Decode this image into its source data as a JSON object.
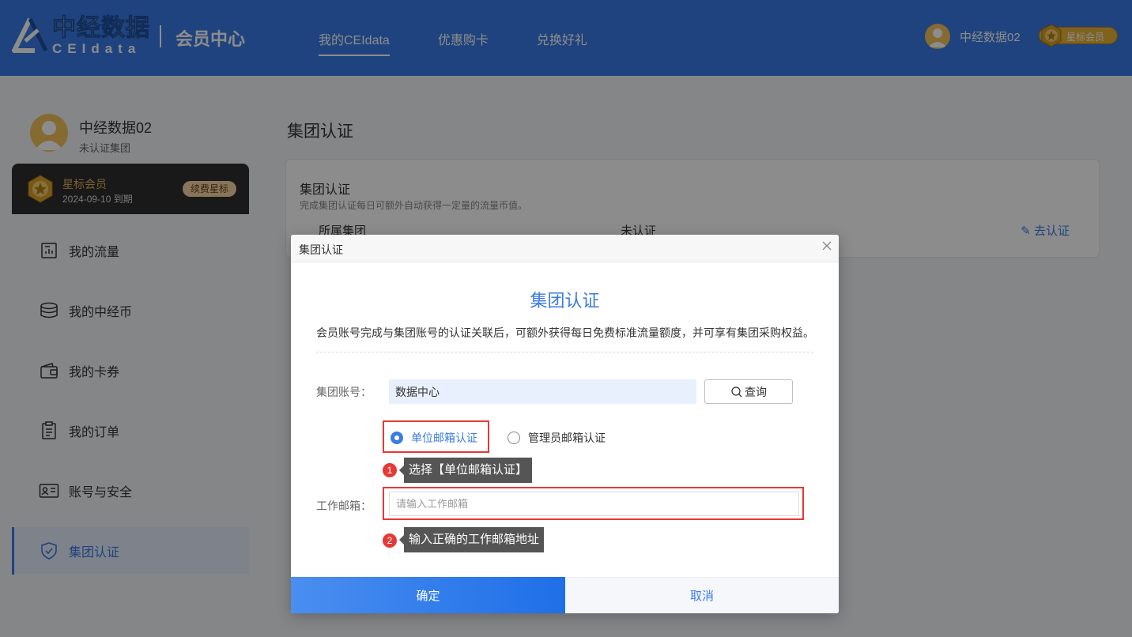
{
  "header": {
    "logo_cn": "中经数据",
    "logo_en": "CEIdata",
    "section_title": "会员中心",
    "nav": [
      {
        "label": "我的CEIdata",
        "active": true
      },
      {
        "label": "优惠购卡",
        "active": false
      },
      {
        "label": "兑换好礼",
        "active": false
      }
    ],
    "user_name": "中经数据02",
    "badge_label": "星标会员"
  },
  "sidebar": {
    "user_name": "中经数据02",
    "user_status": "未认证集团",
    "vip": {
      "title": "星标会员",
      "expiry": "2024-09-10 到期",
      "renew_label": "续费星标"
    },
    "menu": [
      {
        "label": "我的流量",
        "icon": "chart-icon"
      },
      {
        "label": "我的中经币",
        "icon": "coins-icon"
      },
      {
        "label": "我的卡券",
        "icon": "wallet-icon"
      },
      {
        "label": "我的订单",
        "icon": "order-icon"
      },
      {
        "label": "账号与安全",
        "icon": "id-card-icon"
      },
      {
        "label": "集团认证",
        "icon": "shield-check-icon",
        "active": true
      }
    ]
  },
  "main": {
    "title": "集团认证",
    "panel": {
      "title": "集团认证",
      "desc": "完成集团认证每日可额外自动获得一定量的流量币值。",
      "col_group": "所属集团",
      "col_status": "未认证",
      "action": "去认证"
    }
  },
  "modal": {
    "header_title": "集团认证",
    "title": "集团认证",
    "desc": "会员账号完成与集团账号的认证关联后，可额外获得每日免费标准流量额度，并可享有集团采购权益。",
    "account_label": "集团账号：",
    "account_value": "数据中心",
    "query_label": "查询",
    "radio_unit": "单位邮箱认证",
    "radio_admin": "管理员邮箱认证",
    "email_label": "工作邮箱：",
    "email_placeholder": "请输入工作邮箱",
    "confirm_label": "确定",
    "cancel_label": "取消"
  },
  "annotations": [
    {
      "num": "1",
      "text": "选择【单位邮箱认证】"
    },
    {
      "num": "2",
      "text": "输入正确的工作邮箱地址"
    }
  ],
  "colors": {
    "primary": "#3a7be5",
    "header_bg": "#3a7be5",
    "annotation_red": "#e53935",
    "gold": "#e8b337"
  }
}
